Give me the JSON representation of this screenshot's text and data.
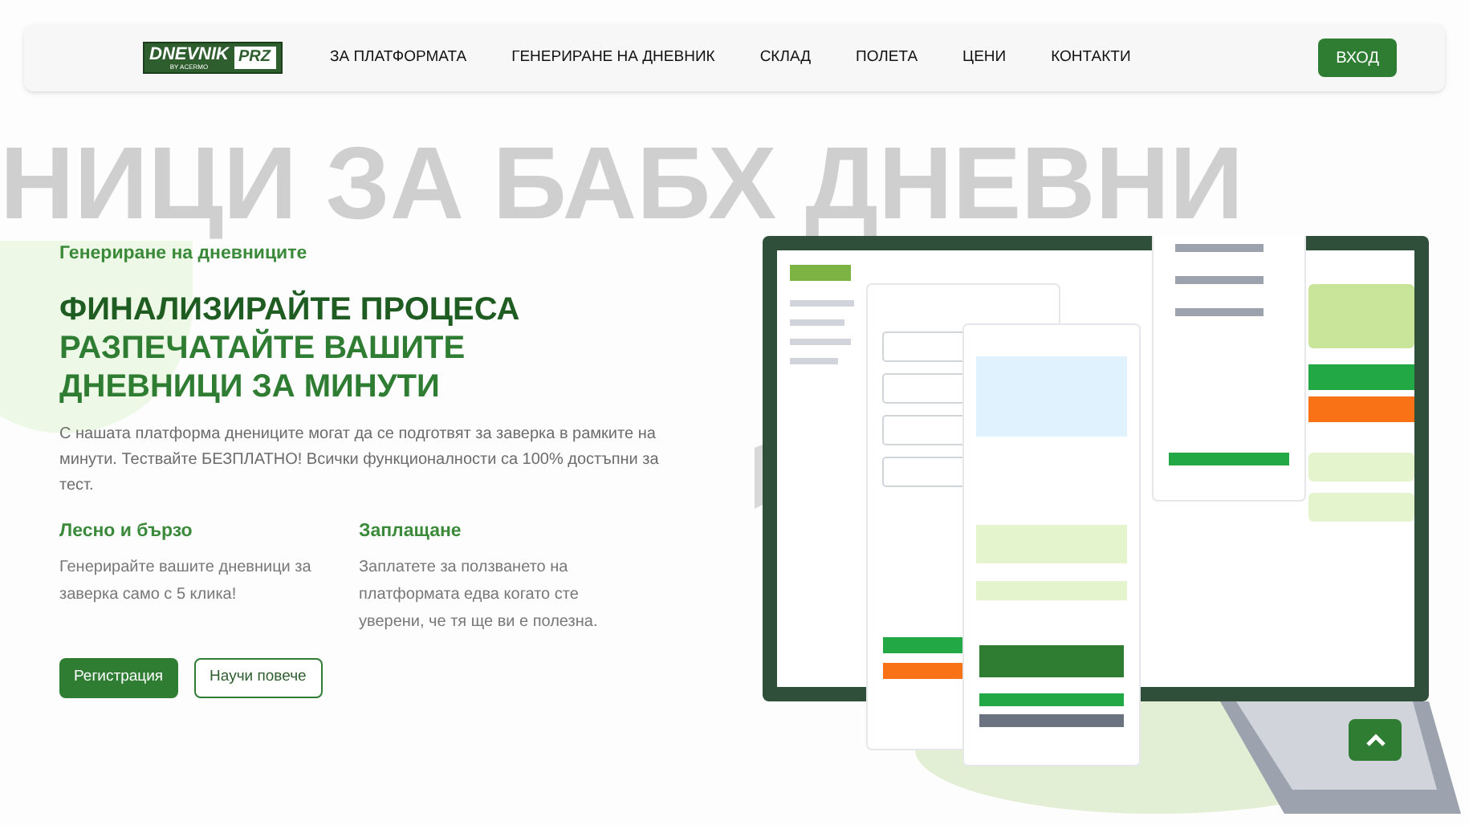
{
  "header": {
    "logo": {
      "name": "DNEVNIK",
      "tagline": "BY ACERMO",
      "badge": "PRZ"
    },
    "nav": [
      {
        "label": "ЗА ПЛАТФОРМАТА"
      },
      {
        "label": "ГЕНЕРИРАНЕ НА ДНЕВНИК"
      },
      {
        "label": "СКЛАД"
      },
      {
        "label": "ПОЛЕТА"
      },
      {
        "label": "ЦЕНИ"
      },
      {
        "label": "КОНТАКТИ"
      }
    ],
    "login_button": "ВХОД"
  },
  "hero": {
    "background_text": "НИЦИ ЗА БАБХ ДНЕВНИ",
    "eyebrow": "Генериране на дневниците",
    "title_lines": [
      "ФИНАЛИЗИРАЙТЕ ПРОЦЕСА",
      "РАЗПЕЧАТАЙТЕ ВАШИТЕ",
      "ДНЕВНИЦИ ЗА МИНУТИ"
    ],
    "description": "С нашата платформа днениците могат да се подготвят за заверка в рамките на минути. Тествайте БЕЗПЛАТНО! Всички функционалности са 100% достъпни за тест.",
    "features": [
      {
        "title": "Лесно и бързо",
        "text": "Генерирайте вашите дневници за заверка само с 5 клика!"
      },
      {
        "title": "Заплащане",
        "text": "Заплатете за ползването на платформата едва когато сте уверени, че тя ще ви е полезна."
      }
    ],
    "buttons": [
      {
        "label": "Регистрация",
        "kind": "primary"
      },
      {
        "label": "Научи повече",
        "kind": "outline"
      }
    ]
  }
}
